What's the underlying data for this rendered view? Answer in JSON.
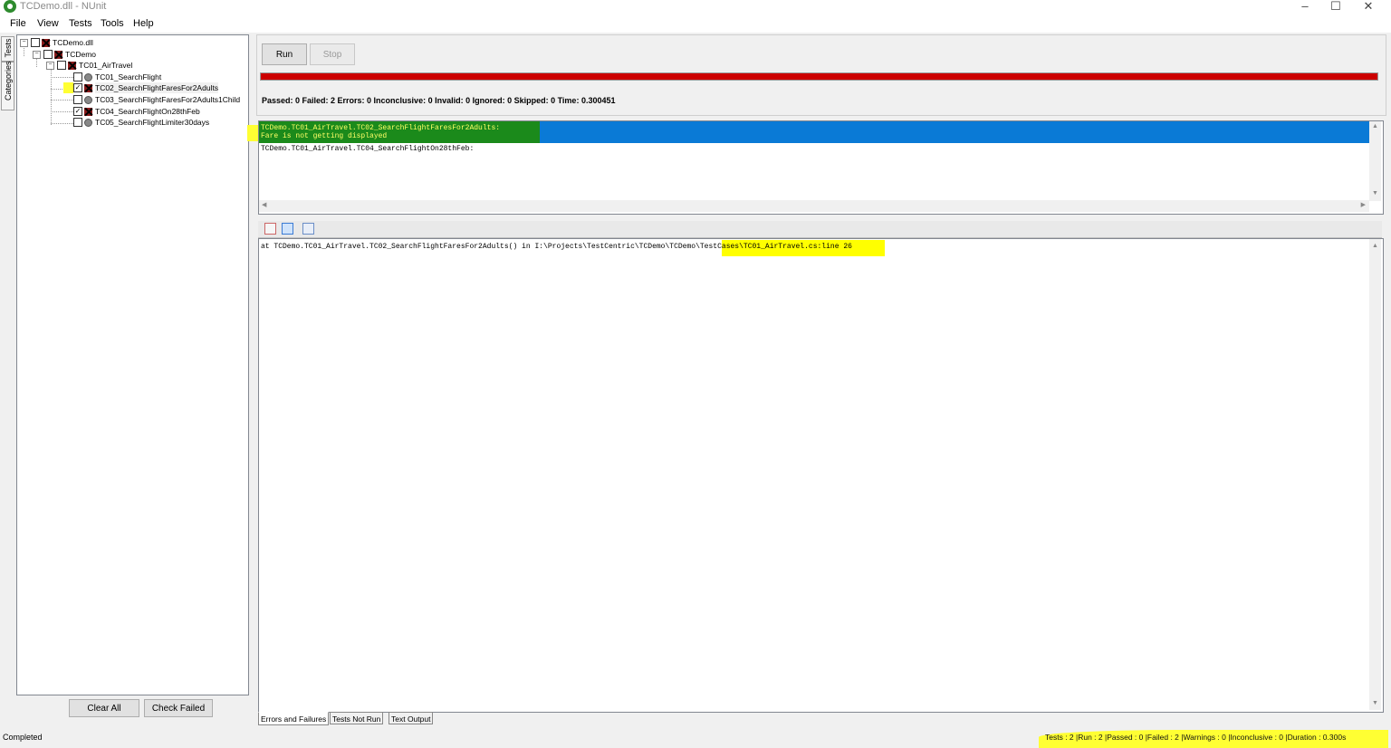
{
  "window": {
    "title": "TCDemo.dll - NUnit",
    "controls": [
      "–",
      "☐",
      "✕"
    ]
  },
  "menu": [
    "File",
    "View",
    "Tests",
    "Tools",
    "Help"
  ],
  "side_tabs": [
    "Tests",
    "Categories"
  ],
  "tree": [
    {
      "label": "TCDemo.dll",
      "status": "failed",
      "checked": false
    },
    {
      "label": "TCDemo",
      "status": "failed",
      "checked": false
    },
    {
      "label": "TC01_AirTravel",
      "status": "failed",
      "checked": false
    },
    {
      "label": "TC01_SearchFlight",
      "status": "notrun",
      "checked": false
    },
    {
      "label": "TC02_SearchFlightFaresFor2Adults",
      "status": "failed",
      "checked": true
    },
    {
      "label": "TC03_SearchFlightFaresFor2Adults1Child",
      "status": "notrun",
      "checked": false
    },
    {
      "label": "TC04_SearchFlightOn28thFeb",
      "status": "failed",
      "checked": true
    },
    {
      "label": "TC05_SearchFlightLimiter30days",
      "status": "notrun",
      "checked": false
    }
  ],
  "tree_buttons": {
    "clear_all": "Clear All",
    "check_failed": "Check Failed"
  },
  "run_buttons": {
    "run": "Run",
    "stop": "Stop"
  },
  "progress": {
    "status": "failed",
    "color": "#cc0000"
  },
  "summary": "Passed: 0  Failed: 2  Errors: 0  Inconclusive: 0  Invalid: 0  Ignored: 0  Skipped: 0  Time: 0.300451",
  "errors": [
    {
      "line1": "TCDemo.TC01_AirTravel.TC02_SearchFlightFaresFor2Adults:",
      "line2": "Fare is not getting displayed",
      "selected": true
    },
    {
      "line1": "TCDemo.TC01_AirTravel.TC04_SearchFlightOn28thFeb:",
      "line2": "",
      "selected": false
    }
  ],
  "stack_trace": {
    "before": "at TCDemo.TC01_AirTravel.TC02_SearchFlightFaresFor2Adults() in I:\\Projects\\TestCentric\\TCDemo\\TCDemo\\TestC",
    "highlighted": "ases\\TC01_AirTravel.cs:line 26"
  },
  "result_tabs": [
    "Errors and Failures",
    "Tests Not Run",
    "Text Output"
  ],
  "status": {
    "left": "Completed",
    "right": "Tests : 2  |Run : 2  |Passed : 0  |Failed : 2  |Warnings : 0  |Inconclusive : 0  |Duration : 0.300s"
  }
}
